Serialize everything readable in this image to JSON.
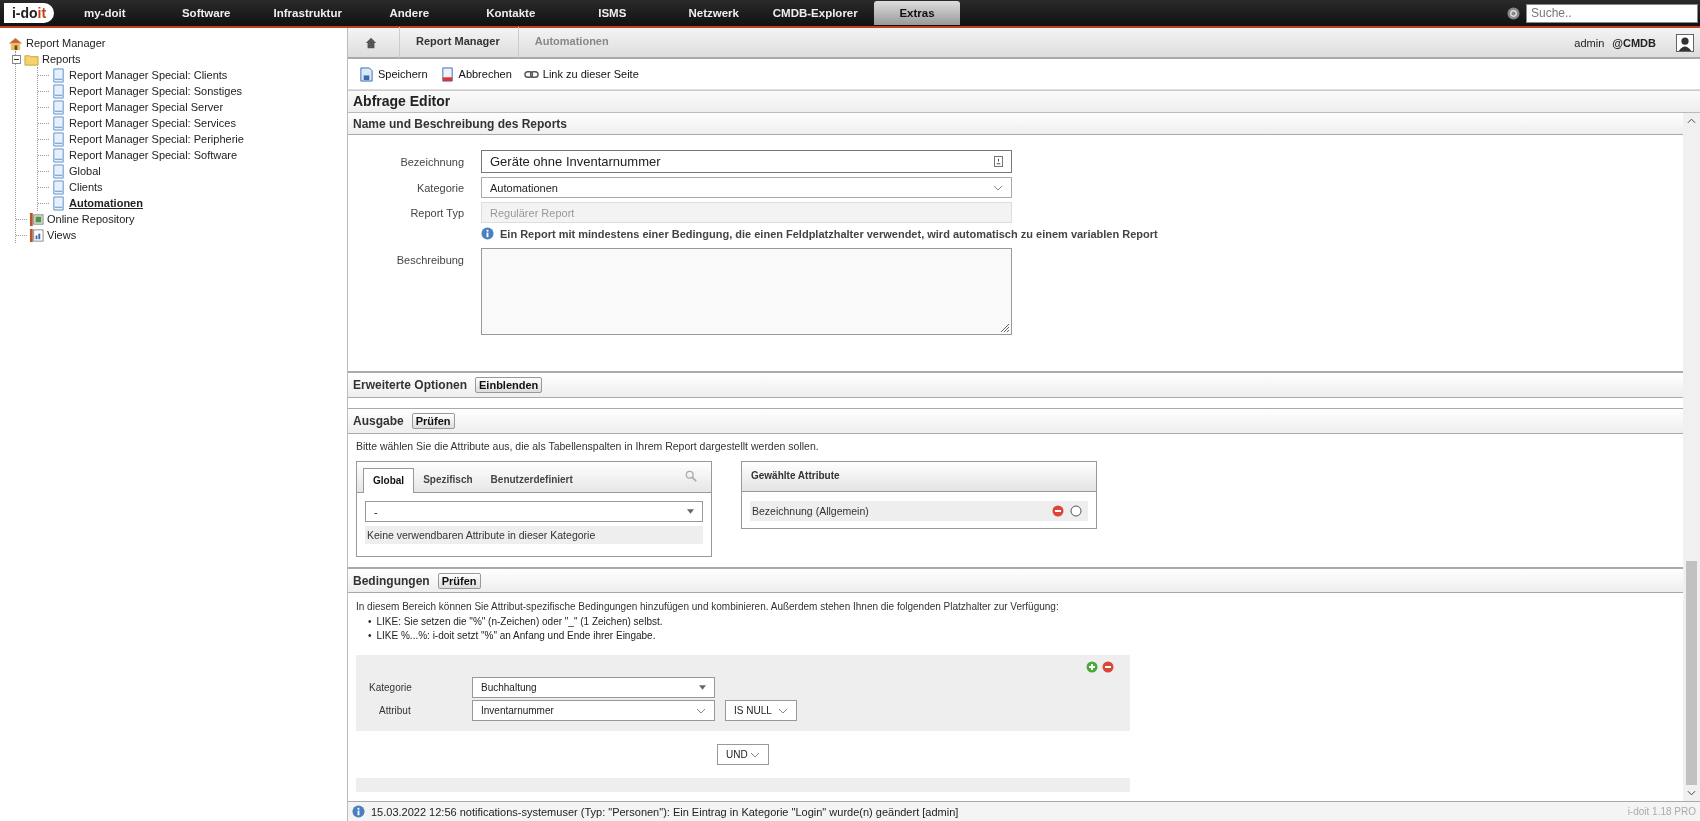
{
  "top_nav": {
    "logo": {
      "text": "i-do",
      "accent": "it"
    },
    "items": [
      {
        "label": "my-doit",
        "selected": false
      },
      {
        "label": "Software",
        "selected": false
      },
      {
        "label": "Infrastruktur",
        "selected": false
      },
      {
        "label": "Andere",
        "selected": false
      },
      {
        "label": "Kontakte",
        "selected": false
      },
      {
        "label": "ISMS",
        "selected": false
      },
      {
        "label": "Netzwerk",
        "selected": false
      },
      {
        "label": "CMDB-Explorer",
        "selected": false
      },
      {
        "label": "Extras",
        "selected": true
      }
    ],
    "search": {
      "placeholder": "Suche.."
    }
  },
  "sidebar": {
    "root": {
      "label": "Report Manager",
      "kind": "home",
      "children": [
        {
          "label": "Reports",
          "kind": "folder",
          "expanded": true,
          "selected": false,
          "children": [
            {
              "label": "Report Manager Special: Clients",
              "kind": "report",
              "selected": false
            },
            {
              "label": "Report Manager Special: Sonstiges",
              "kind": "report",
              "selected": false
            },
            {
              "label": "Report Manager Special Server",
              "kind": "report",
              "selected": false
            },
            {
              "label": "Report Manager Special: Services",
              "kind": "report",
              "selected": false
            },
            {
              "label": "Report Manager Special: Peripherie",
              "kind": "report",
              "selected": false
            },
            {
              "label": "Report Manager Special: Software",
              "kind": "report",
              "selected": false
            },
            {
              "label": "Global",
              "kind": "report",
              "selected": false
            },
            {
              "label": "Clients",
              "kind": "report",
              "selected": false
            },
            {
              "label": "Automationen",
              "kind": "report",
              "selected": true
            }
          ]
        },
        {
          "label": "Online Repository",
          "kind": "repository",
          "selected": false
        },
        {
          "label": "Views",
          "kind": "views",
          "selected": false
        }
      ]
    }
  },
  "breadcrumb": [
    "Report Manager",
    "Automationen"
  ],
  "user": {
    "name": "admin",
    "tenant": "@CMDB"
  },
  "toolbar": [
    {
      "label": "Speichern",
      "kind": "save"
    },
    {
      "label": "Abbrechen",
      "kind": "cancel"
    },
    {
      "label": "Link zu dieser Seite",
      "kind": "link"
    }
  ],
  "editor": {
    "title": "Abfrage Editor",
    "name_section": {
      "title": "Name und Beschreibung des Reports",
      "fields": [
        {
          "kind": "text",
          "label": "Bezeichnung",
          "value": "Geräte ohne Inventarnummer"
        },
        {
          "kind": "select",
          "label": "Kategorie",
          "value": "Automationen"
        },
        {
          "kind": "disabled",
          "label": "Report Typ",
          "value": "Regulärer Report"
        }
      ],
      "info": "Ein Report mit mindestens einer Bedingung, die einen Feldplatzhalter verwendet, wird automatisch zu einem variablen Report",
      "description_label": "Beschreibung"
    },
    "advanced": {
      "title": "Erweiterte Optionen",
      "button": "Einblenden"
    },
    "output": {
      "title": "Ausgabe",
      "button": "Prüfen",
      "hint": "Bitte wählen Sie die Attribute aus, die als Tabellenspalten in Ihrem Report dargestellt werden sollen.",
      "tabs": [
        {
          "label": "Global",
          "selected": true
        },
        {
          "label": "Spezifisch",
          "selected": false
        },
        {
          "label": "Benutzerdefiniert",
          "selected": false
        }
      ],
      "category_select": "-",
      "empty_text": "Keine verwendbaren Attribute in dieser Kategorie",
      "selected_header": "Gewählte Attribute",
      "selected_attributes": [
        {
          "label": "Bezeichnung (Allgemein)",
          "selected": false
        }
      ]
    },
    "conditions": {
      "title": "Bedingungen",
      "button": "Prüfen",
      "intro": "In diesem Bereich können Sie Attribut-spezifische Bedingungen hinzufügen und kombinieren. Außerdem stehen Ihnen die folgenden Platzhalter zur Verfügung:",
      "bullet_marker": "•",
      "bullets": [
        "LIKE: Sie setzen die \"%\" (n-Zeichen) oder \"_\" (1 Zeichen) selbst.",
        "LIKE %...%: i-doit setzt \"%\" an Anfang und Ende ihrer Eingabe."
      ],
      "rows": [
        {
          "label": "Kategorie",
          "value": "Buchhaltung"
        },
        {
          "label": "Attribut",
          "value": "Inventarnummer",
          "operator": "IS NULL"
        }
      ],
      "connector": "UND"
    }
  },
  "status_bar": {
    "message": "15.03.2022 12:56 notifications-systemuser (Typ: \"Personen\"): Ein Eintrag in Kategorie \"Login\" wurde(n) geändert [admin]",
    "version": "i-doit 1.18 PRO"
  }
}
